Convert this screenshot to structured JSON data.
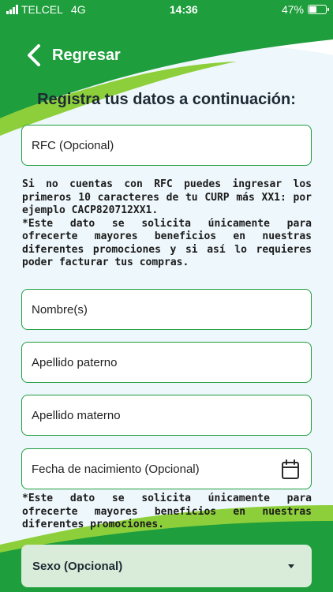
{
  "status_bar": {
    "carrier": "TELCEL",
    "network": "4G",
    "time": "14:36",
    "battery": "47%",
    "battery_level": 0.47
  },
  "nav": {
    "back_label": "Regresar"
  },
  "page": {
    "title": "Registra tus datos a continuación:"
  },
  "form": {
    "rfc_placeholder": "RFC (Opcional)",
    "rfc_note_1": "Si no cuentas con RFC puedes ingresar los primeros 10 caracteres de tu CURP más XX1: por ejemplo CACP820712XX1.",
    "rfc_note_2": "*Este dato se solicita únicamente para ofrecerte mayores beneficios en nuestras diferentes promociones y si así lo requieres poder facturar tus compras.",
    "name_placeholder": "Nombre(s)",
    "paternal_placeholder": "Apellido paterno",
    "maternal_placeholder": "Apellido materno",
    "birthdate_placeholder": "Fecha de nacimiento (Opcional)",
    "birthdate_note": "*Este dato se solicita únicamente para ofrecerte mayores beneficios en nuestras diferentes promociones.",
    "sex_label": "Sexo (Opcional)"
  },
  "colors": {
    "primary_green": "#1e9e3c",
    "light_green": "#8ccf3a",
    "pale_blue": "#eef7fb",
    "select_bg": "#d8ecd9"
  },
  "icons": {
    "back": "chevron-left-icon",
    "calendar": "calendar-icon",
    "dropdown": "caret-down-icon"
  }
}
